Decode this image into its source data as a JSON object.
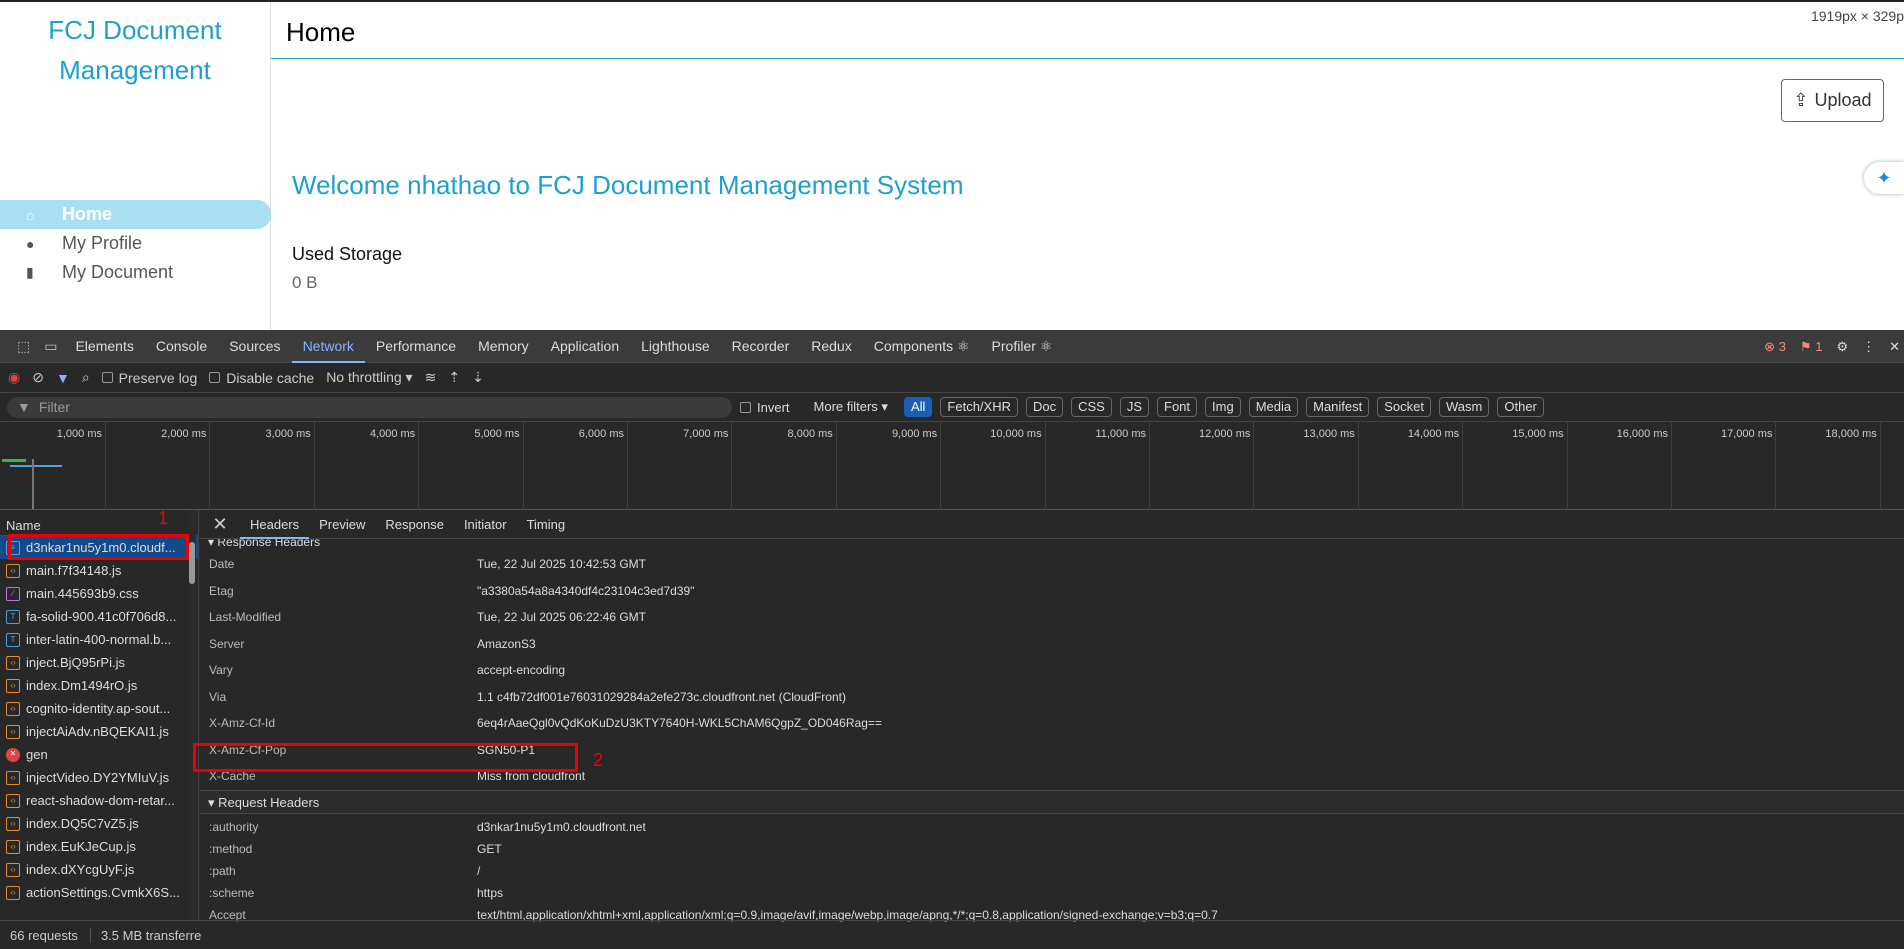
{
  "app": {
    "brand": "FCJ Document Management",
    "nav": [
      {
        "label": "Home",
        "icon": "home-icon"
      },
      {
        "label": "My Profile",
        "icon": "user-icon"
      },
      {
        "label": "My Document",
        "icon": "file-icon"
      }
    ],
    "page_title": "Home",
    "size_note": "1919px × 329p",
    "upload_label": "Upload",
    "welcome": "Welcome nhathao to FCJ Document Management System",
    "storage_label": "Used Storage",
    "storage_value": "0 B"
  },
  "devtools": {
    "tabs": [
      "Elements",
      "Console",
      "Sources",
      "Network",
      "Performance",
      "Memory",
      "Application",
      "Lighthouse",
      "Recorder",
      "Redux",
      "Components ⚛",
      "Profiler ⚛"
    ],
    "errors": "3",
    "warnings": "1",
    "toolbar": {
      "preserve_log": "Preserve log",
      "disable_cache": "Disable cache",
      "throttling": "No throttling"
    },
    "filter": {
      "placeholder": "Filter",
      "invert": "Invert",
      "more_filters": "More filters",
      "types": [
        "All",
        "Fetch/XHR",
        "Doc",
        "CSS",
        "JS",
        "Font",
        "Img",
        "Media",
        "Manifest",
        "Socket",
        "Wasm",
        "Other"
      ]
    },
    "timeline_ticks": [
      "1,000 ms",
      "2,000 ms",
      "3,000 ms",
      "4,000 ms",
      "5,000 ms",
      "6,000 ms",
      "7,000 ms",
      "8,000 ms",
      "9,000 ms",
      "10,000 ms",
      "11,000 ms",
      "12,000 ms",
      "13,000 ms",
      "14,000 ms",
      "15,000 ms",
      "16,000 ms",
      "17,000 ms",
      "18,000 ms"
    ],
    "name_header": "Name",
    "requests": [
      {
        "name": "d3nkar1nu5y1m0.cloudf...",
        "type": "doc"
      },
      {
        "name": "main.f7f34148.js",
        "type": "js"
      },
      {
        "name": "main.445693b9.css",
        "type": "css"
      },
      {
        "name": "fa-solid-900.41c0f706d8...",
        "type": "font"
      },
      {
        "name": "inter-latin-400-normal.b...",
        "type": "font"
      },
      {
        "name": "inject.BjQ95rPi.js",
        "type": "js"
      },
      {
        "name": "index.Dm1494rO.js",
        "type": "js"
      },
      {
        "name": "cognito-identity.ap-sout...",
        "type": "js"
      },
      {
        "name": "injectAiAdv.nBQEKAI1.js",
        "type": "js"
      },
      {
        "name": "gen",
        "type": "err"
      },
      {
        "name": "injectVideo.DY2YMIuV.js",
        "type": "js"
      },
      {
        "name": "react-shadow-dom-retar...",
        "type": "js"
      },
      {
        "name": "index.DQ5C7vZ5.js",
        "type": "js"
      },
      {
        "name": "index.EuKJeCup.js",
        "type": "js"
      },
      {
        "name": "index.dXYcgUyF.js",
        "type": "js"
      },
      {
        "name": "actionSettings.CvmkX6S...",
        "type": "js"
      }
    ],
    "detail_tabs": [
      "Headers",
      "Preview",
      "Response",
      "Initiator",
      "Timing"
    ],
    "response_section": "▾ Response Headers",
    "response_headers": [
      [
        "Date",
        "Tue, 22 Jul 2025 10:42:53 GMT"
      ],
      [
        "Etag",
        "\"a3380a54a8a4340df4c23104c3ed7d39\""
      ],
      [
        "Last-Modified",
        "Tue, 22 Jul 2025 06:22:46 GMT"
      ],
      [
        "Server",
        "AmazonS3"
      ],
      [
        "Vary",
        "accept-encoding"
      ],
      [
        "Via",
        "1.1 c4fb72df001e76031029284a2efe273c.cloudfront.net (CloudFront)"
      ],
      [
        "X-Amz-Cf-Id",
        "6eq4rAaeQgl0vQdKoKuDzU3KTY7640H-WKL5ChAM6QgpZ_OD046Rag=="
      ],
      [
        "X-Amz-Cf-Pop",
        "SGN50-P1"
      ],
      [
        "X-Cache",
        "Miss from cloudfront"
      ]
    ],
    "request_section": "▾ Request Headers",
    "request_headers": [
      [
        ":authority",
        "d3nkar1nu5y1m0.cloudfront.net"
      ],
      [
        ":method",
        "GET"
      ],
      [
        ":path",
        "/"
      ],
      [
        ":scheme",
        "https"
      ],
      [
        "Accept",
        "text/html,application/xhtml+xml,application/xml;q=0.9,image/avif,image/webp,image/apng,*/*;q=0.8,application/signed-exchange;v=b3;q=0.7"
      ]
    ],
    "status": {
      "requests": "66 requests",
      "transferred": "3.5 MB transferre"
    },
    "annotations": [
      "1",
      "2"
    ]
  }
}
